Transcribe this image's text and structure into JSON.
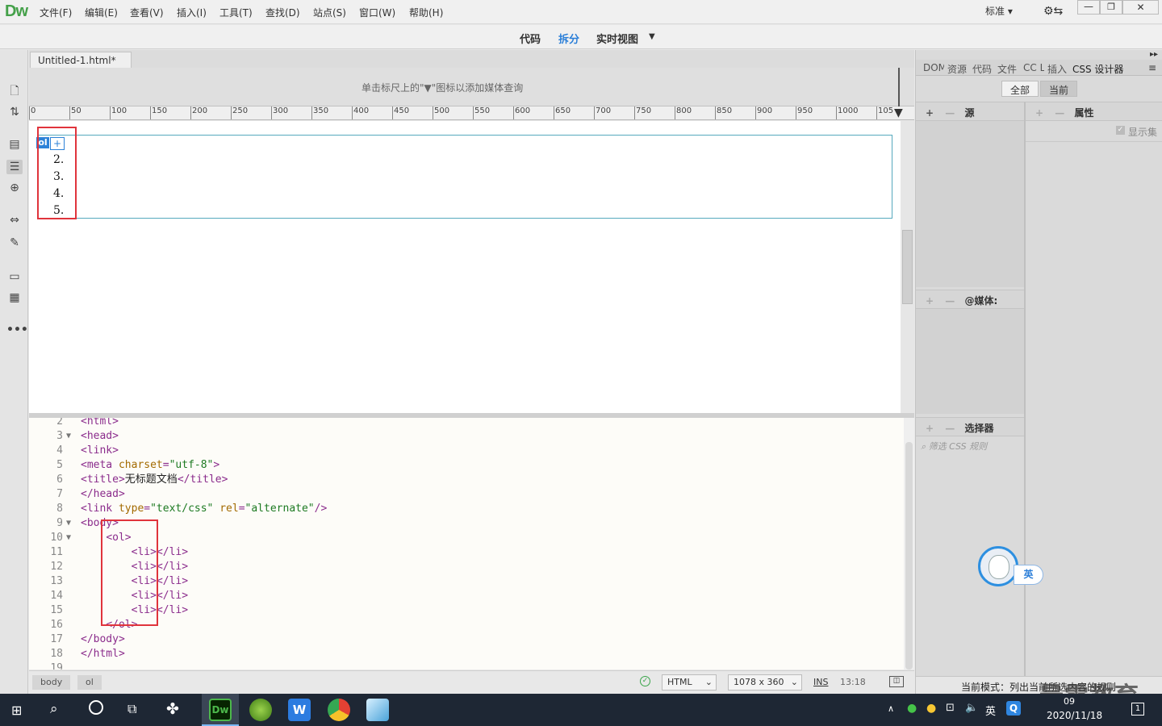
{
  "app": {
    "logo": "Dw"
  },
  "menu": [
    "文件(F)",
    "编辑(E)",
    "查看(V)",
    "插入(I)",
    "工具(T)",
    "查找(D)",
    "站点(S)",
    "窗口(W)",
    "帮助(H)"
  ],
  "layout_selector": "标准",
  "views": {
    "code": "代码",
    "split": "拆分",
    "live": "实时视图"
  },
  "document": {
    "tab_title": "Untitled-1.html*",
    "close": "×"
  },
  "media_query_hint": "单击标尺上的\"▼\"图标以添加媒体查询",
  "ruler_ticks": [
    "0",
    "50",
    "100",
    "150",
    "200",
    "250",
    "300",
    "350",
    "400",
    "450",
    "500",
    "550",
    "600",
    "650",
    "700",
    "750",
    "800",
    "850",
    "900",
    "950",
    "1000",
    "105"
  ],
  "design_view": {
    "ol_tag": "ol",
    "ol_plus": "+",
    "list_items": [
      "2.",
      "3.",
      "4.",
      "5."
    ]
  },
  "code_lines": [
    {
      "n": "2",
      "text": "<html>",
      "fold": ""
    },
    {
      "n": "3",
      "text": "<head>",
      "fold": "▼"
    },
    {
      "n": "4",
      "text": "<link>",
      "fold": ""
    },
    {
      "n": "5",
      "text": "<meta charset=\"utf-8\">",
      "fold": ""
    },
    {
      "n": "6",
      "text": "<title>无标题文档</title>",
      "fold": ""
    },
    {
      "n": "7",
      "text": "</head>",
      "fold": ""
    },
    {
      "n": "8",
      "text": "<link type=\"text/css\" rel=\"alternate\"/>",
      "fold": ""
    },
    {
      "n": "9",
      "text": "<body>",
      "fold": "▼"
    },
    {
      "n": "10",
      "text": "    <ol>",
      "fold": "▼"
    },
    {
      "n": "11",
      "text": "        <li></li>",
      "fold": ""
    },
    {
      "n": "12",
      "text": "        <li></li>",
      "fold": ""
    },
    {
      "n": "13",
      "text": "        <li></li>",
      "fold": ""
    },
    {
      "n": "14",
      "text": "        <li></li>",
      "fold": ""
    },
    {
      "n": "15",
      "text": "        <li></li>",
      "fold": ""
    },
    {
      "n": "16",
      "text": "    </ol>",
      "fold": ""
    },
    {
      "n": "17",
      "text": "</body>",
      "fold": ""
    },
    {
      "n": "18",
      "text": "</html>",
      "fold": ""
    },
    {
      "n": "19",
      "text": "",
      "fold": ""
    }
  ],
  "status": {
    "crumbs": [
      "body",
      "ol"
    ],
    "doc_type": "HTML",
    "size": "1078 x 360",
    "mode": "INS",
    "position": "13:18"
  },
  "right_panel": {
    "tabs": [
      "DOM",
      "资源",
      "代码",
      "文件",
      "CC L",
      "插入",
      "CSS 设计器"
    ],
    "filter": {
      "all": "全部",
      "current": "当前"
    },
    "sources": "源",
    "properties": "属性",
    "show_set": "显示集",
    "media": "@媒体:",
    "selectors": "选择器",
    "selector_filter": "筛选 CSS 规则",
    "footer": "当前模式：列出当前所选内容的规则"
  },
  "ime_badge": "英",
  "watermark": "最需教育",
  "taskbar": {
    "date": "2020/11/18",
    "time": "09",
    "tray_lang": "英",
    "notifications": "1"
  }
}
